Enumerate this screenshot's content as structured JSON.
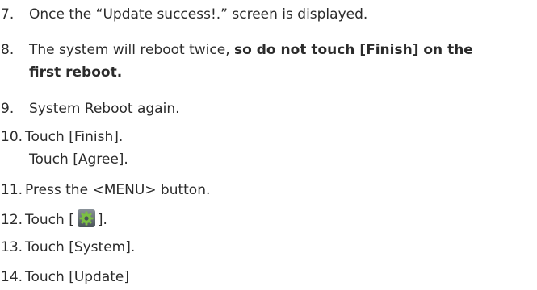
{
  "steps": [
    {
      "num": "7.",
      "text": "Once the “Update success!.” screen is displayed."
    },
    {
      "num": "8.",
      "text_a": "The system will reboot twice, ",
      "bold_a": "so do not touch [Finish] on the",
      "bold_b": "first reboot."
    },
    {
      "num": "9.",
      "text": "System Reboot again."
    },
    {
      "num": "10.",
      "text": "Touch [Finish].",
      "text2": "Touch [Agree]."
    },
    {
      "num": "11.",
      "text": "Press the <MENU> button."
    },
    {
      "num": "12.",
      "before": "Touch [",
      "after": "].",
      "icon": "settings-gear-icon"
    },
    {
      "num": "13.",
      "text": "Touch [System]."
    },
    {
      "num": "14.",
      "text": "Touch [Update]"
    }
  ],
  "colors": {
    "text": "#2b2b2b",
    "gear_green": "#7bc043",
    "gear_box": "#5a636a"
  }
}
